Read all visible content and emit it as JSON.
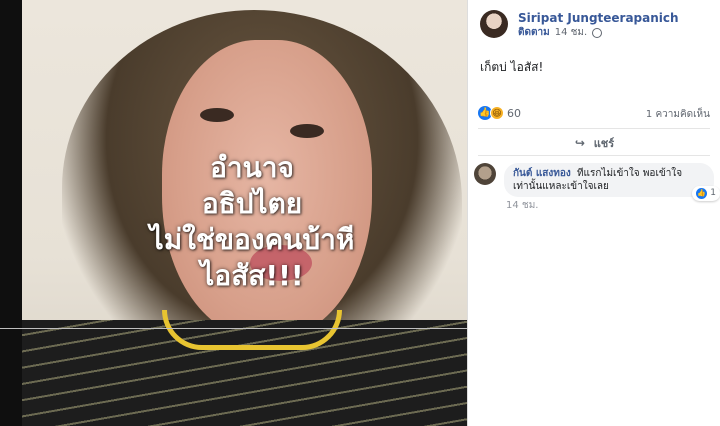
{
  "photo": {
    "overlay_text": [
      "อำนาจ",
      "อธิปไตย",
      "ไม่ใช่ของคนบ้าหี",
      "ไอสัส!!!"
    ]
  },
  "post": {
    "author": "Siripat Jungteerapanich",
    "follow": "ติดตาม",
    "time": "14 ชม.",
    "caption": "เก็ตบ่ ไอสัส!",
    "reaction_count": "60",
    "comment_count": "1 ความคิดเห็น",
    "share_label": "แชร์"
  },
  "comment": {
    "author": "กันต์ แสงทอง",
    "text": "ทีแรกไม่เข้าใจ พอเข้าใจ เท่านั้นแหละเข้าใจเลย",
    "reactions": "1",
    "time": "14 ชม."
  },
  "icons": [
    "like-icon",
    "haha-icon",
    "globe-icon",
    "share-icon"
  ]
}
